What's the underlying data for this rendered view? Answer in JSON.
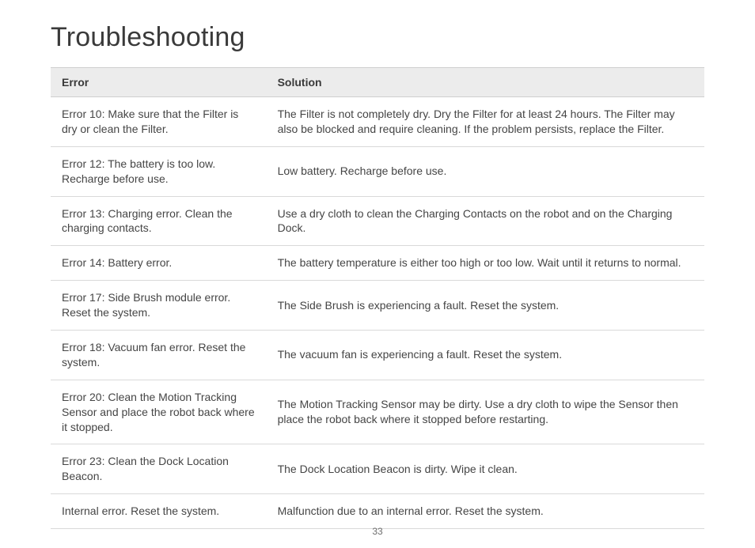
{
  "title": "Troubleshooting",
  "page_number": "33",
  "table": {
    "headers": {
      "error": "Error",
      "solution": "Solution"
    },
    "rows": [
      {
        "error": "Error 10: Make sure that the Filter is dry or clean the Filter.",
        "solution": "The Filter is not completely dry. Dry the Filter for at least 24 hours. The Filter may also be blocked and require cleaning. If the problem persists, replace the Filter."
      },
      {
        "error": "Error 12: The battery is too low. Recharge before use.",
        "solution": "Low battery. Recharge before use."
      },
      {
        "error": "Error 13: Charging error. Clean the charging contacts.",
        "solution": "Use a dry cloth to clean the Charging Contacts on the robot and on the Charging Dock."
      },
      {
        "error": "Error 14: Battery error.",
        "solution": "The battery temperature is either too high or too low. Wait until it returns to normal."
      },
      {
        "error": "Error 17: Side Brush module error. Reset the system.",
        "solution": "The Side Brush is experiencing a fault. Reset the system."
      },
      {
        "error": "Error 18: Vacuum fan error. Reset the system.",
        "solution": "The vacuum fan is experiencing a fault. Reset the system."
      },
      {
        "error": "Error 20: Clean the Motion Tracking Sensor and place the robot back where it stopped.",
        "solution": "The Motion Tracking Sensor may be dirty. Use a dry cloth to wipe the Sensor then place the robot back where it stopped before restarting."
      },
      {
        "error": "Error 23: Clean the Dock Location Beacon.",
        "solution": "The Dock Location Beacon is dirty. Wipe it clean."
      },
      {
        "error": "Internal error. Reset the system.",
        "solution": "Malfunction due to an internal error. Reset the system."
      }
    ]
  }
}
